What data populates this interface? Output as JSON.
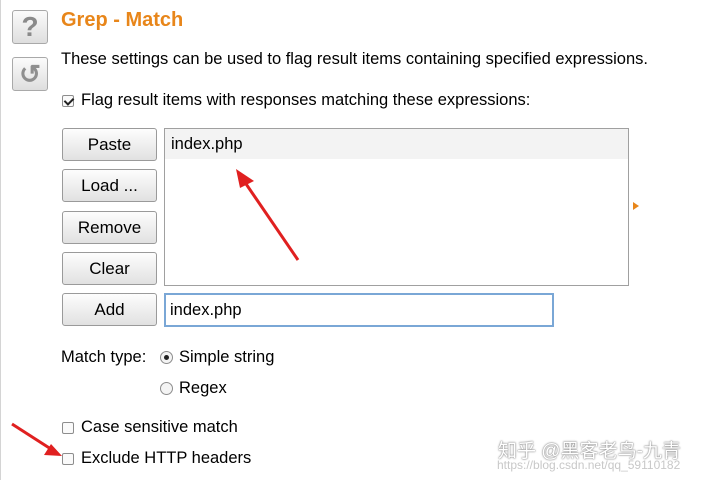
{
  "side": {
    "help_glyph": "?",
    "refresh_glyph": "↺"
  },
  "title": "Grep - Match",
  "description": "These settings can be used to flag result items containing specified expressions.",
  "flag_checkbox": {
    "label": "Flag result items with responses matching these expressions:",
    "checked": true
  },
  "buttons": {
    "paste": "Paste",
    "load": "Load ...",
    "remove": "Remove",
    "clear": "Clear",
    "add": "Add"
  },
  "expressions": [
    "index.php"
  ],
  "add_input": {
    "value": "index.php"
  },
  "match_type": {
    "label": "Match type:",
    "options": [
      {
        "label": "Simple string",
        "selected": true
      },
      {
        "label": "Regex",
        "selected": false
      }
    ]
  },
  "case_sensitive": {
    "label": "Case sensitive match",
    "checked": false
  },
  "exclude_headers": {
    "label": "Exclude HTTP headers",
    "checked": false
  },
  "watermark": {
    "main": "知乎 @黑客老鸟-九青",
    "sub": "https://blog.csdn.net/qq_59110182"
  },
  "colors": {
    "accent": "#e8861a",
    "annotation_arrow": "#e02020",
    "input_focus": "#7aa7d6"
  }
}
